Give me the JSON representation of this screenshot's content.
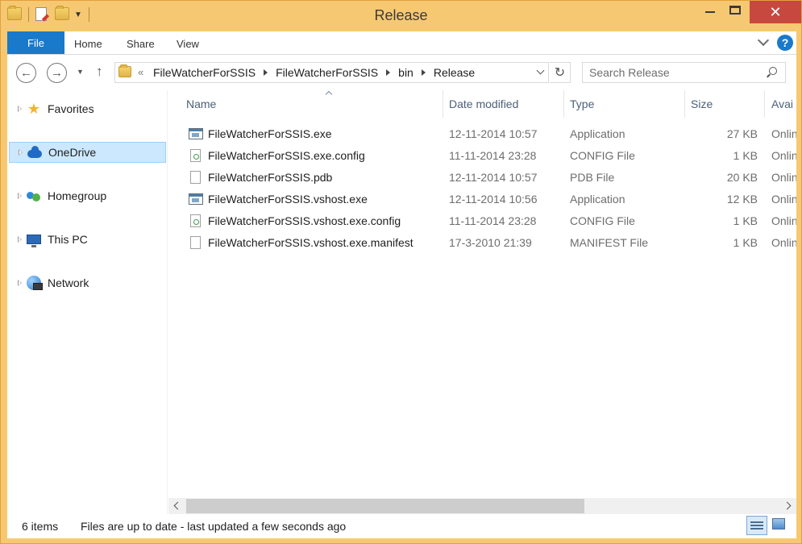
{
  "window": {
    "title": "Release"
  },
  "ribbon": {
    "file_tab": "File",
    "tabs": [
      "Home",
      "Share",
      "View"
    ],
    "help": "?"
  },
  "navbar": {
    "breadcrumb_overflow": "«",
    "breadcrumbs": [
      "FileWatcherForSSIS",
      "FileWatcherForSSIS",
      "bin",
      "Release"
    ],
    "search_placeholder": "Search Release"
  },
  "navpane": {
    "items": [
      {
        "label": "Favorites",
        "icon": "star-icon",
        "selected": false
      },
      {
        "label": "OneDrive",
        "icon": "cloud-icon",
        "selected": true
      },
      {
        "label": "Homegroup",
        "icon": "homegroup-icon",
        "selected": false
      },
      {
        "label": "This PC",
        "icon": "computer-icon",
        "selected": false
      },
      {
        "label": "Network",
        "icon": "network-icon",
        "selected": false
      }
    ]
  },
  "filelist": {
    "columns": [
      "Name",
      "Date modified",
      "Type",
      "Size",
      "Avai"
    ],
    "rows": [
      {
        "name": "FileWatcherForSSIS.exe",
        "date": "12-11-2014 10:57",
        "type": "Application",
        "size": "27 KB",
        "avail": "Onlin",
        "icon": "application-icon"
      },
      {
        "name": "FileWatcherForSSIS.exe.config",
        "date": "11-11-2014 23:28",
        "type": "CONFIG File",
        "size": "1 KB",
        "avail": "Onlin",
        "icon": "config-file-icon"
      },
      {
        "name": "FileWatcherForSSIS.pdb",
        "date": "12-11-2014 10:57",
        "type": "PDB File",
        "size": "20 KB",
        "avail": "Onlin",
        "icon": "document-icon"
      },
      {
        "name": "FileWatcherForSSIS.vshost.exe",
        "date": "12-11-2014 10:56",
        "type": "Application",
        "size": "12 KB",
        "avail": "Onlin",
        "icon": "application-icon"
      },
      {
        "name": "FileWatcherForSSIS.vshost.exe.config",
        "date": "11-11-2014 23:28",
        "type": "CONFIG File",
        "size": "1 KB",
        "avail": "Onlin",
        "icon": "config-file-icon"
      },
      {
        "name": "FileWatcherForSSIS.vshost.exe.manifest",
        "date": "17-3-2010 21:39",
        "type": "MANIFEST File",
        "size": "1 KB",
        "avail": "Onlin",
        "icon": "document-icon"
      }
    ]
  },
  "statusbar": {
    "item_count": "6 items",
    "sync_status": "Files are up to date - last updated a few seconds ago"
  },
  "colors": {
    "frame": "#f7c872",
    "accent": "#1979ca",
    "selection": "#cce8ff",
    "close_button": "#c7483f"
  }
}
